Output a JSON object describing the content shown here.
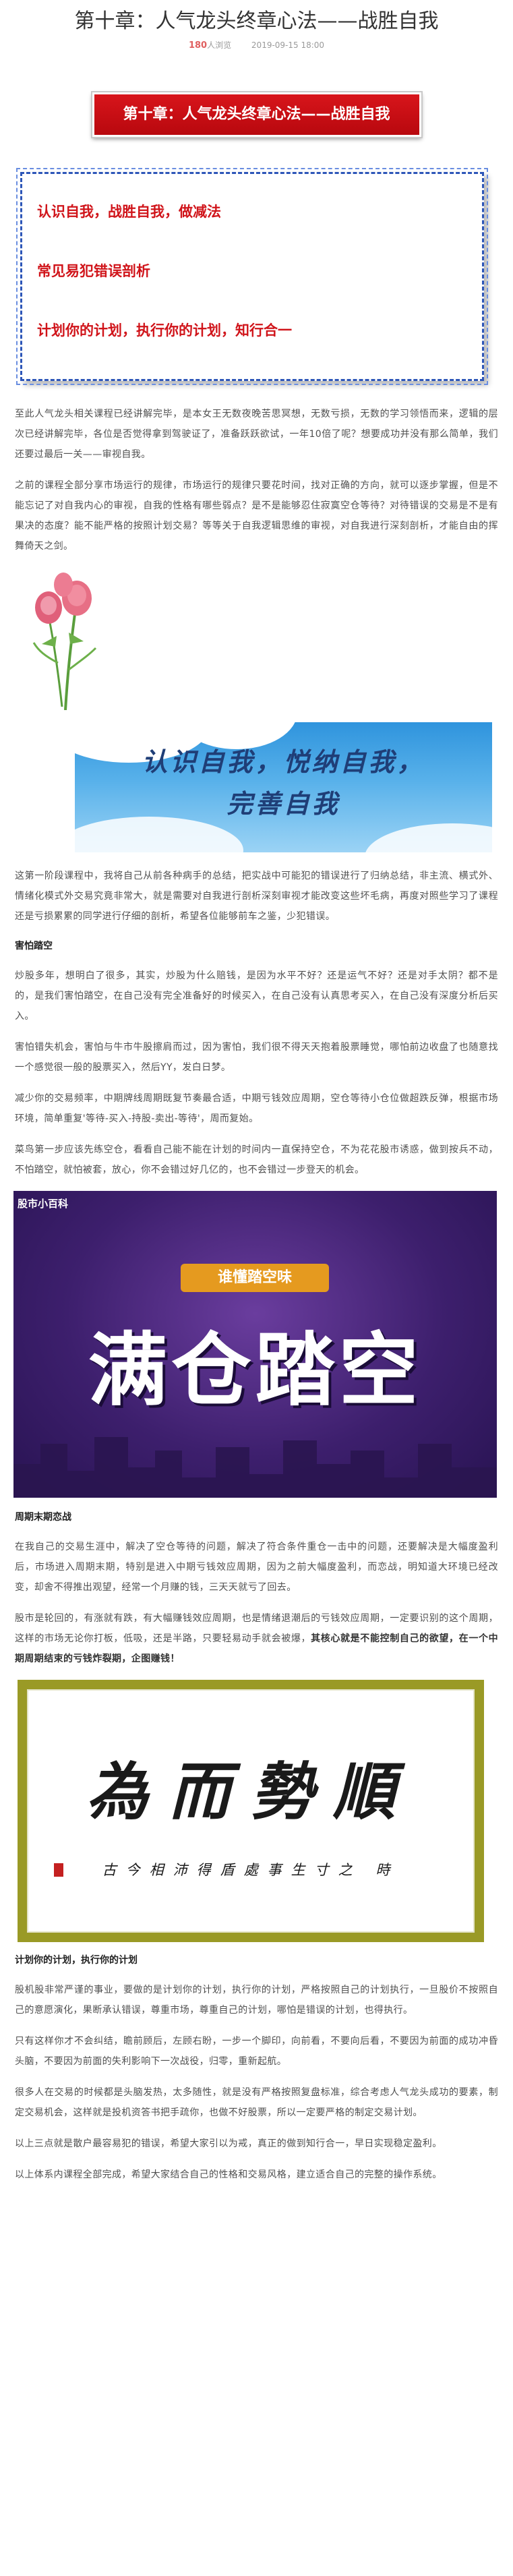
{
  "header": {
    "title": "第十章：人气龙头终章心法——战胜自我",
    "views_count": "180",
    "views_label": "人浏览",
    "date": "2019-09-15 18:00"
  },
  "banner": {
    "text": "第十章：人气龙头终章心法——战胜自我"
  },
  "outline": [
    "认识自我，战胜自我，做减法",
    "常见易犯错误剖析",
    "计划你的计划，执行你的计划，知行合一"
  ],
  "intro_paragraphs": [
    "至此人气龙头相关课程已经讲解完毕，是本女王无数夜晚苦思冥想，无数亏损，无数的学习领悟而来，逻辑的层次已经讲解完毕，各位是否觉得拿到驾驶证了，准备跃跃欲试，一年10倍了呢？想要成功并没有那么简单，我们还要过最后一关——审视自我。",
    "之前的课程全部分享市场运行的规律，市场运行的规律只要花时间，找对正确的方向，就可以逐步掌握，但是不能忘记了对自我内心的审视，自我的性格有哪些弱点？是不是能够忍住寂寞空仓等待？对待错误的交易是不是有果决的态度？能不能严格的按照计划交易？等等关于自我逻辑思维的审视，对自我进行深刻剖析，才能自由的挥舞倚天之剑。"
  ],
  "calligraphy_banner": {
    "line1": "认识自我，悦纳自我，",
    "line2": "完善自我"
  },
  "stage_paragraph": "这第一阶段课程中，我将自己从前各种病手的总结，把实战中可能犯的错误进行了归纳总结，非主流、横式外、情绪化模式外交易究竟非常大，就是需要对自我进行剖析深刻审视才能改变这些坏毛病，再度对照些学习了课程还是亏损累累的同学进行仔细的剖析，希望各位能够前车之鉴，少犯错误。",
  "section1": {
    "heading": "害怕踏空",
    "paragraphs": [
      "炒股多年，想明白了很多，其实，炒股为什么赔钱，是因为水平不好？还是运气不好？还是对手太阴？都不是的，是我们害怕踏空，在自己没有完全准备好的时候买入，在自己没有认真思考买入，在自己没有深度分析后买入。",
      "害怕错失机会，害怕与牛市牛股擦肩而过，因为害怕，我们很不得天天抱着股票睡觉，哪怕前边收盘了也随意找一个感觉很一般的股票买入，然后YY，发白日梦。",
      "减少你的交易频率，中期牌线周期既复节奏最合适，中期亏钱效应周期，空仓等待小仓位做超跌反弹，根据市场环境，简单重复'等待-买入-持股-卖出-等待'，周而复始。",
      "菜鸟第一步应该先练空仓，看看自己能不能在计划的时间内一直保持空仓，不为花花股市诱惑，做到按兵不动，不怕踏空，就怕被套，放心，你不会错过好几亿的，也不会错过一步登天的机会。"
    ]
  },
  "purple_banner": {
    "corner": "股市小百科",
    "ribbon": "谁懂踏空味",
    "big": "满仓踏空"
  },
  "section2": {
    "heading": "周期末期恋战",
    "paragraphs": [
      "在我自己的交易生涯中，解决了空仓等待的问题，解决了符合条件重仓一击中的问题，还要解决是大幅度盈利后，市场进入周期末期，特别是进入中期亏钱效应周期，因为之前大幅度盈利，而恋战，明知道大环境已经改变，却舍不得推出观望，经常一个月赚的钱，三天天就亏了回去。",
      "股市是轮回的，有涨就有跌，有大幅赚钱效应周期，也是情绪退潮后的亏钱效应周期，一定要识别的这个周期，这样的市场无论你打板，低吸，还是半路，只要轻易动手就会被爆，其核心就是不能控制自己的欲望，在一个中期周期结束的亏钱炸裂期，企图赚钱！"
    ],
    "emphasis": "其核心就是不能控制自己的欲望，在一个中期周期结束的亏钱炸裂期，企图赚钱！"
  },
  "framed_calligraphy": {
    "big": "為而勢順",
    "small": "古今相沛得盾處事生寸之 時"
  },
  "section3": {
    "heading": "计划你的计划，执行你的计划",
    "paragraphs": [
      "股机股非常严谨的事业，要做的是计划你的计划，执行你的计划，严格按照自己的计划执行，一旦股价不按照自己的意愿演化，果断承认错误，尊重市场，尊重自己的计划，哪怕是错误的计划，也得执行。",
      "只有这样你才不会纠结，瞻前顾后，左顾右盼，一步一个脚印，向前看，不要向后看，不要因为前面的成功冲昏头脑，不要因为前面的失利影响下一次战役，归零，重新起航。",
      "很多人在交易的时候都是头脑发热，太多随性，就是没有严格按照复盘标准，综合考虑人气龙头成功的要素，制定交易机会，这样就是投机资答书把手疏你，也做不好股票，所以一定要严格的制定交易计划。",
      "以上三点就是散户最容易犯的错误，希望大家引以为戒，真正的做到知行合一，早日实现稳定盈利。",
      "以上体系内课程全部完成，希望大家结合自己的性格和交易风格，建立适合自己的完整的操作系统。"
    ]
  }
}
